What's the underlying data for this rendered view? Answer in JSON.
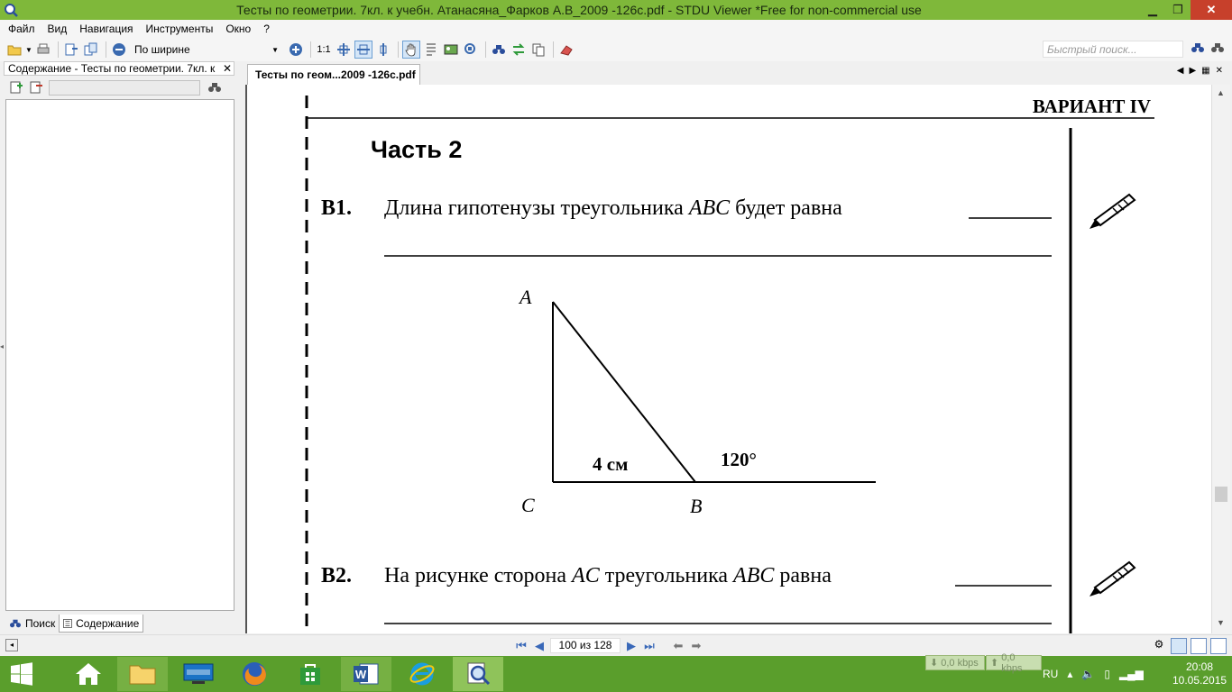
{
  "window": {
    "title": "Тесты по геометрии. 7кл. к учебн. Атанасяна_Фарков А.В_2009 -126с.pdf - STDU Viewer *Free for non-commercial use",
    "minimize": "▁",
    "maximize": "❐",
    "close": "✕"
  },
  "menu": [
    "Файл",
    "Вид",
    "Навигация",
    "Инструменты",
    "Окно",
    "?"
  ],
  "toolbar": {
    "zoom_value": "По ширине",
    "actual_size": "1:1",
    "quick_search_placeholder": "Быстрый поиск..."
  },
  "left_panel": {
    "header": "Содержание - Тесты по геометрии. 7кл. к",
    "close": "✕",
    "tabs": [
      "Поиск",
      "Содержание"
    ]
  },
  "doc_tab": {
    "label": "Тесты по геом...2009 -126с.pdf"
  },
  "document": {
    "variant": "ВАРИАНТ IV",
    "part": "Часть 2",
    "questions": [
      {
        "num": "В1.",
        "text_before": "Длина гипотенузы треугольника ",
        "italic": "ABC",
        "text_after": " будет равна"
      },
      {
        "num": "В2.",
        "text_before": "На рисунке сторона ",
        "italic": "AC",
        "text_mid": " треугольника ",
        "italic2": "ABC",
        "text_after": " равна"
      }
    ],
    "figure": {
      "vertex_a": "A",
      "vertex_b": "B",
      "vertex_c": "C",
      "side_label": "4 см",
      "angle_label": "120°"
    }
  },
  "status": {
    "page": "100 из 128"
  },
  "taskbar": {
    "upload": "0,0 kbps",
    "download": "0,0 kbps",
    "lang": "RU",
    "time": "20:08",
    "date": "10.05.2015"
  }
}
